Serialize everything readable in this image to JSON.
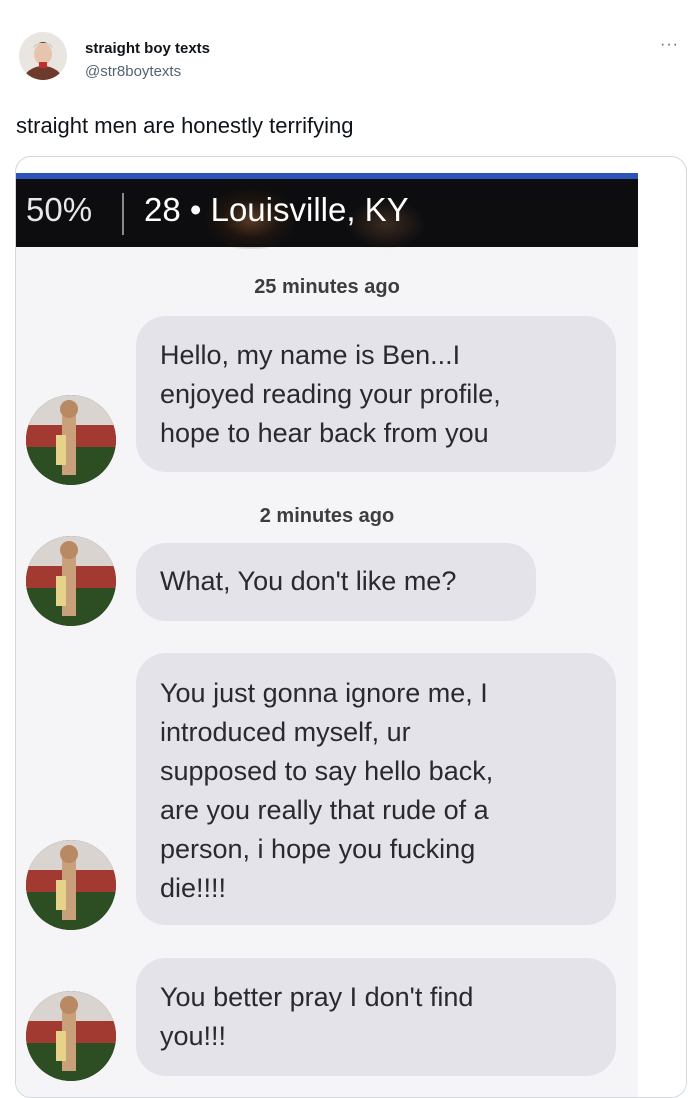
{
  "tweet": {
    "author_name": "straight boy texts",
    "author_handle": "@str8boytexts",
    "more_label": "···",
    "text": "straight men are honestly terrifying"
  },
  "screenshot": {
    "profile": {
      "percent": "50%",
      "age_location": "28 • Louisville, KY"
    },
    "timestamps": [
      "25 minutes ago",
      "2 minutes ago"
    ],
    "messages": [
      "Hello, my name is Ben...I\nenjoyed reading your profile,\nhope to hear back from you",
      "What, You don't like me?",
      "You just gonna ignore me, I\nintroduced myself, ur\nsupposed to say hello back,\nare you really that rude of a\nperson, i hope you fucking\ndie!!!!",
      "You better pray I don't find\nyou!!!"
    ]
  },
  "colors": {
    "bubble": "#e4e3ea",
    "profile_bar": "#0d0d0f",
    "accent_top": "#2b54b8",
    "handle": "#536471"
  },
  "icons": [
    "more-icon",
    "user-avatar",
    "sender-avatar"
  ]
}
